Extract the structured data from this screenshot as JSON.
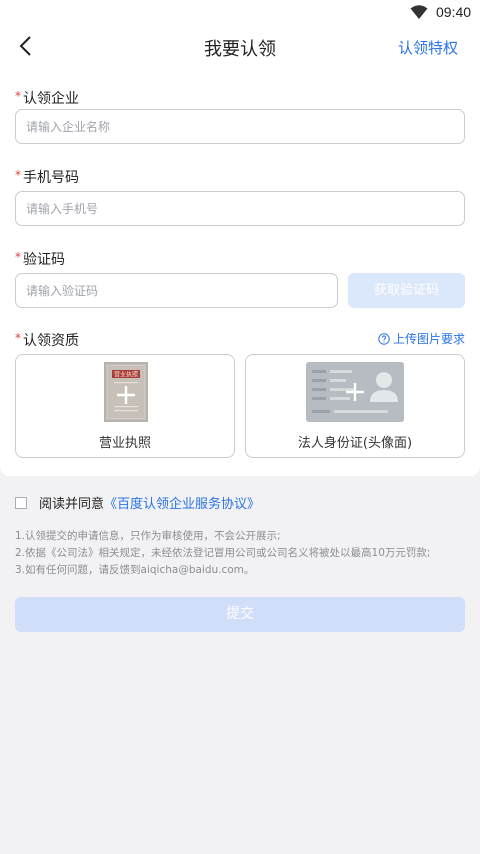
{
  "status": {
    "time": "09:40"
  },
  "nav": {
    "title": "我要认领",
    "right_link": "认领特权"
  },
  "form": {
    "company": {
      "required": "*",
      "label": "认领企业",
      "placeholder": "请输入企业名称"
    },
    "phone": {
      "required": "*",
      "label": "手机号码",
      "placeholder": "请输入手机号"
    },
    "code": {
      "required": "*",
      "label": "验证码",
      "placeholder": "请输入验证码",
      "button": "获取验证码"
    },
    "qualification": {
      "required": "*",
      "label": "认领资质",
      "upload_requirements": "上传图片要求",
      "license": {
        "caption": "营业执照",
        "doc_title": "营业执照"
      },
      "idcard": {
        "caption": "法人身份证(头像面)"
      }
    }
  },
  "agreement": {
    "prefix": "阅读并同意",
    "link": "《百度认领企业服务协议》"
  },
  "notes": [
    "1.认领提交的申请信息，只作为审核使用，不会公开展示;",
    "2.依据《公司法》相关规定，未经依法登记冒用公司或公司名义将被处以最高10万元罚款;",
    "3.如有任何问题，请反馈到aiqicha@baidu.com。"
  ],
  "submit": {
    "label": "提交"
  },
  "colors": {
    "accent": "#2a73e8",
    "required": "#e23d3d",
    "disabled_button": "#d1defa"
  }
}
